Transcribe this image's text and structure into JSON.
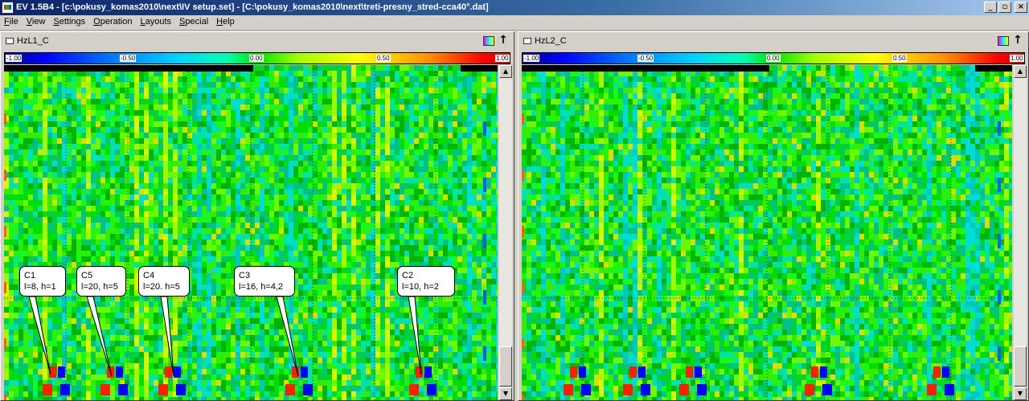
{
  "window": {
    "title": "EV 1.5B4 - [c:\\pokusy_komas2010\\next\\IV setup.set] - [C:\\pokusy_komas2010\\next\\treti-presny_stred-cca40°.dat]",
    "buttons": {
      "minimize": "_",
      "restore": "▫",
      "close": "×"
    }
  },
  "menu": [
    "File",
    "View",
    "Settings",
    "Operation",
    "Layouts",
    "Special",
    "Help"
  ],
  "scale_ticks": [
    "-1.00",
    "-0.50",
    "0.00",
    "0.50",
    "1.00"
  ],
  "panels": [
    {
      "title": "HzL1_C"
    },
    {
      "title": "HzL2_C"
    }
  ],
  "callouts": [
    {
      "name": "C1",
      "params": "l=8, h=1"
    },
    {
      "name": "C5",
      "params": "l=20, h=5"
    },
    {
      "name": "C4",
      "params": "l=20. h=5"
    },
    {
      "name": "C3",
      "params": "l=16, h=4,2"
    },
    {
      "name": "C2",
      "params": "l=10, h=2"
    }
  ],
  "scroll": {
    "up": "▲",
    "down": "▼"
  },
  "colors": {
    "title_gradient_start": "#0a246a",
    "title_gradient_end": "#a6caf0",
    "heat_base": "#00c000",
    "defect_red": "#ff2000",
    "defect_blue": "#0000ff"
  }
}
